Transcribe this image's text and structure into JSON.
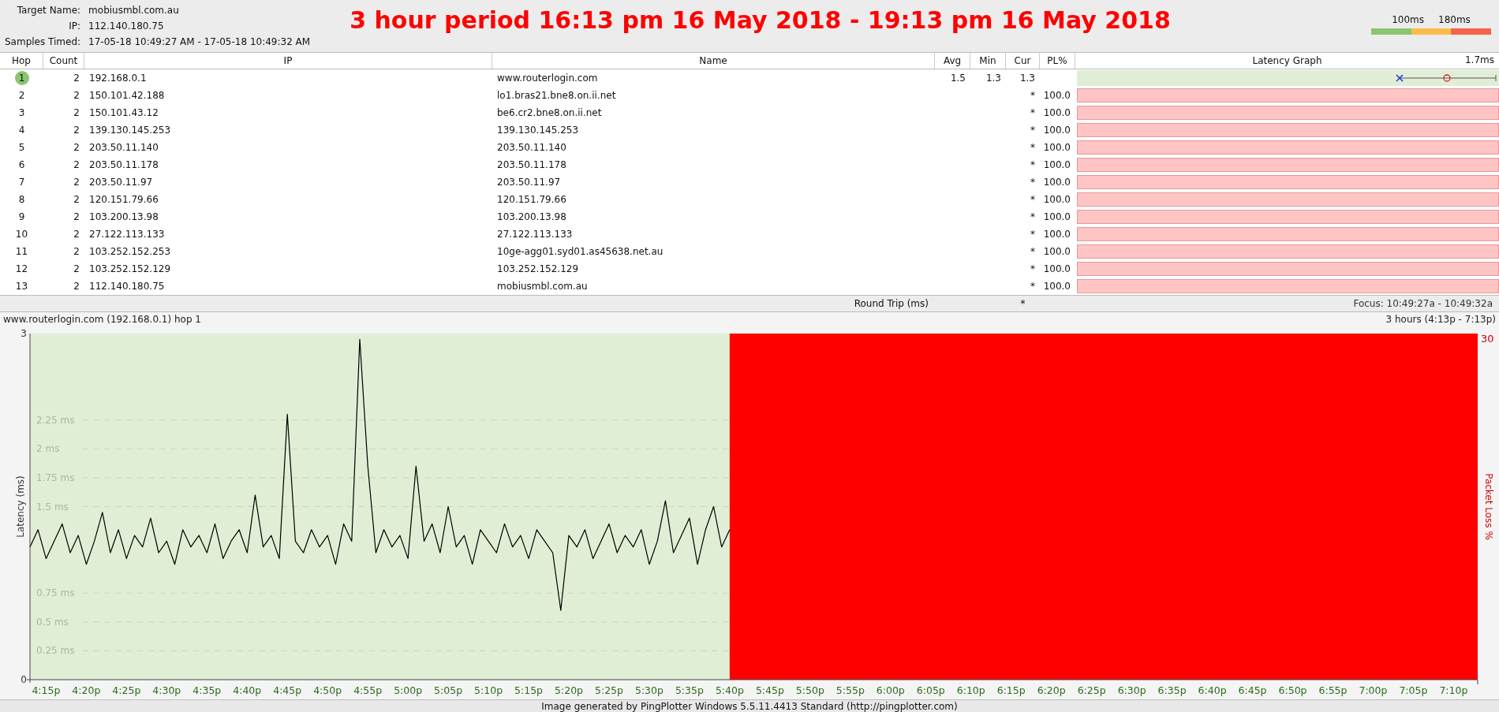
{
  "target": {
    "fields": [
      {
        "label": "Target Name:",
        "value": "mobiusmbl.com.au"
      },
      {
        "label": "IP:",
        "value": "112.140.180.75"
      },
      {
        "label": "Samples Timed:",
        "value": "17-05-18 10:49:27 AM - 17-05-18 10:49:32 AM"
      }
    ]
  },
  "headline": "3 hour period 16:13 pm 16 May 2018 - 19:13 pm 16 May 2018",
  "legend": {
    "labels": [
      "100ms",
      "180ms"
    ],
    "segments": [
      {
        "color": "#8cc56f"
      },
      {
        "color": "#fbbd4a"
      },
      {
        "color": "#f4634a"
      }
    ]
  },
  "table": {
    "columns": [
      "Hop",
      "Count",
      "IP",
      "Name",
      "Avg",
      "Min",
      "Cur",
      "PL%",
      "Latency Graph"
    ],
    "graph_scale": "1.7ms",
    "rows": [
      {
        "hop": "1",
        "color": "#8cc56f",
        "count": "2",
        "ip": "192.168.0.1",
        "name": "www.routerlogin.com",
        "avg": "1.5",
        "min": "1.3",
        "cur": "1.3",
        "kind": "latency"
      },
      {
        "hop": "2",
        "count": "2",
        "ip": "150.101.42.188",
        "name": "lo1.bras21.bne8.on.ii.net",
        "cur": "*",
        "pl": "100.0",
        "kind": "loss"
      },
      {
        "hop": "3",
        "count": "2",
        "ip": "150.101.43.12",
        "name": "be6.cr2.bne8.on.ii.net",
        "cur": "*",
        "pl": "100.0",
        "kind": "loss"
      },
      {
        "hop": "4",
        "count": "2",
        "ip": "139.130.145.253",
        "name": "139.130.145.253",
        "cur": "*",
        "pl": "100.0",
        "kind": "loss"
      },
      {
        "hop": "5",
        "count": "2",
        "ip": "203.50.11.140",
        "name": "203.50.11.140",
        "cur": "*",
        "pl": "100.0",
        "kind": "loss"
      },
      {
        "hop": "6",
        "count": "2",
        "ip": "203.50.11.178",
        "name": "203.50.11.178",
        "cur": "*",
        "pl": "100.0",
        "kind": "loss"
      },
      {
        "hop": "7",
        "count": "2",
        "ip": "203.50.11.97",
        "name": "203.50.11.97",
        "cur": "*",
        "pl": "100.0",
        "kind": "loss"
      },
      {
        "hop": "8",
        "count": "2",
        "ip": "120.151.79.66",
        "name": "120.151.79.66",
        "cur": "*",
        "pl": "100.0",
        "kind": "loss"
      },
      {
        "hop": "9",
        "count": "2",
        "ip": "103.200.13.98",
        "name": "103.200.13.98",
        "cur": "*",
        "pl": "100.0",
        "kind": "loss"
      },
      {
        "hop": "10",
        "count": "2",
        "ip": "27.122.113.133",
        "name": "27.122.113.133",
        "cur": "*",
        "pl": "100.0",
        "kind": "loss"
      },
      {
        "hop": "11",
        "count": "2",
        "ip": "103.252.152.253",
        "name": "10ge-agg01.syd01.as45638.net.au",
        "cur": "*",
        "pl": "100.0",
        "kind": "loss"
      },
      {
        "hop": "12",
        "count": "2",
        "ip": "103.252.152.129",
        "name": "103.252.152.129",
        "cur": "*",
        "pl": "100.0",
        "kind": "loss"
      },
      {
        "hop": "13",
        "count": "2",
        "ip": "112.140.180.75",
        "name": "mobiusmbl.com.au",
        "cur": "*",
        "pl": "100.0",
        "kind": "loss"
      }
    ],
    "summary": {
      "label": "Round Trip (ms)",
      "cur": "*",
      "focus": "Focus: 10:49:27a - 10:49:32a"
    }
  },
  "hop_chart": {
    "title": "www.routerlogin.com (192.168.0.1) hop 1",
    "range": "3 hours (4:13p - 7:13p)",
    "loss_scale_label": "30",
    "axis_min_label": "0",
    "axis_max_label": "3",
    "loss_axis_title": "Packet Loss %",
    "chart_data": {
      "type": "line",
      "ylabel": "Latency (ms)",
      "ylim": [
        0,
        3
      ],
      "grid": true,
      "categories": [
        null,
        null,
        "4:15p",
        null,
        null,
        null,
        null,
        "4:20p",
        null,
        null,
        null,
        null,
        "4:25p",
        null,
        null,
        null,
        null,
        "4:30p",
        null,
        null,
        null,
        null,
        "4:35p",
        null,
        null,
        null,
        null,
        "4:40p",
        null,
        null,
        null,
        null,
        "4:45p",
        null,
        null,
        null,
        null,
        "4:50p",
        null,
        null,
        null,
        null,
        "4:55p",
        null,
        null,
        null,
        null,
        "5:00p",
        null,
        null,
        null,
        null,
        "5:05p",
        null,
        null,
        null,
        null,
        "5:10p",
        null,
        null,
        null,
        null,
        "5:15p",
        null,
        null,
        null,
        null,
        "5:20p",
        null,
        null,
        null,
        null,
        "5:25p",
        null,
        null,
        null,
        null,
        "5:30p",
        null,
        null,
        null,
        null,
        "5:35p",
        null,
        null,
        null,
        null,
        "5:40p",
        null,
        null,
        null,
        null,
        "5:45p",
        null,
        null,
        null,
        null,
        "5:50p",
        null,
        null,
        null,
        null,
        "5:55p",
        null,
        null,
        null,
        null,
        "6:00p",
        null,
        null,
        null,
        null,
        "6:05p",
        null,
        null,
        null,
        null,
        "6:10p",
        null,
        null,
        null,
        null,
        "6:15p",
        null,
        null,
        null,
        null,
        "6:20p",
        null,
        null,
        null,
        null,
        "6:25p",
        null,
        null,
        null,
        null,
        "6:30p",
        null,
        null,
        null,
        null,
        "6:35p",
        null,
        null,
        null,
        null,
        "6:40p",
        null,
        null,
        null,
        null,
        "6:45p",
        null,
        null,
        null,
        null,
        "6:50p",
        null,
        null,
        null,
        null,
        "6:55p",
        null,
        null,
        null,
        null,
        "7:00p",
        null,
        null,
        null,
        null,
        "7:05p",
        null,
        null,
        null,
        null,
        "7:10p",
        null,
        null,
        null
      ],
      "series": [
        {
          "color": "#000000",
          "values": [
            1.15,
            1.3,
            1.05,
            1.2,
            1.35,
            1.1,
            1.25,
            1.0,
            1.2,
            1.45,
            1.1,
            1.3,
            1.05,
            1.25,
            1.15,
            1.4,
            1.1,
            1.2,
            1.0,
            1.3,
            1.15,
            1.25,
            1.1,
            1.35,
            1.05,
            1.2,
            1.3,
            1.1,
            1.6,
            1.15,
            1.25,
            1.05,
            2.3,
            1.2,
            1.1,
            1.3,
            1.15,
            1.25,
            1.0,
            1.35,
            1.2,
            2.95,
            1.85,
            1.1,
            1.3,
            1.15,
            1.25,
            1.05,
            1.85,
            1.2,
            1.35,
            1.1,
            1.5,
            1.15,
            1.25,
            1.0,
            1.3,
            1.2,
            1.1,
            1.35,
            1.15,
            1.25,
            1.05,
            1.3,
            1.2,
            1.1,
            0.6,
            1.25,
            1.15,
            1.3,
            1.05,
            1.2,
            1.35,
            1.1,
            1.25,
            1.15,
            1.3,
            1.0,
            1.2,
            1.55,
            1.1,
            1.25,
            1.4,
            1.0,
            1.3,
            1.5,
            1.15,
            1.3,
            null,
            null,
            null,
            null,
            null,
            null,
            null,
            null,
            null,
            null,
            null,
            null,
            null,
            null,
            null,
            null,
            null,
            null,
            null,
            null,
            null,
            null,
            null,
            null,
            null,
            null,
            null,
            null,
            null,
            null,
            null,
            null,
            null,
            null,
            null,
            null,
            null,
            null,
            null,
            null,
            null,
            null,
            null,
            null,
            null,
            null,
            null,
            null,
            null,
            null,
            null,
            null,
            null,
            null,
            null,
            null,
            null,
            null,
            null,
            null,
            null,
            null,
            null,
            null,
            null,
            null,
            null,
            null,
            null,
            null,
            null,
            null,
            null,
            null,
            null,
            null,
            null,
            null,
            null,
            null,
            null,
            null,
            null,
            null,
            null,
            null,
            null,
            null,
            null,
            null,
            null,
            null,
            null
          ]
        }
      ],
      "yticks": [
        {
          "value": 0.25,
          "label": "0.25 ms"
        },
        {
          "value": 0.5,
          "label": "0.5 ms"
        },
        {
          "value": 0.75,
          "label": "0.75 ms"
        },
        {
          "value": 1.5,
          "label": "1.5 ms"
        },
        {
          "value": 1.75,
          "label": "1.75 ms"
        },
        {
          "value": 2,
          "label": "2 ms"
        },
        {
          "value": 2.25,
          "label": "2.25 ms"
        }
      ]
    }
  },
  "footer": "Image generated by PingPlotter Windows 5.5.11.4413 Standard (http://pingplotter.com)"
}
